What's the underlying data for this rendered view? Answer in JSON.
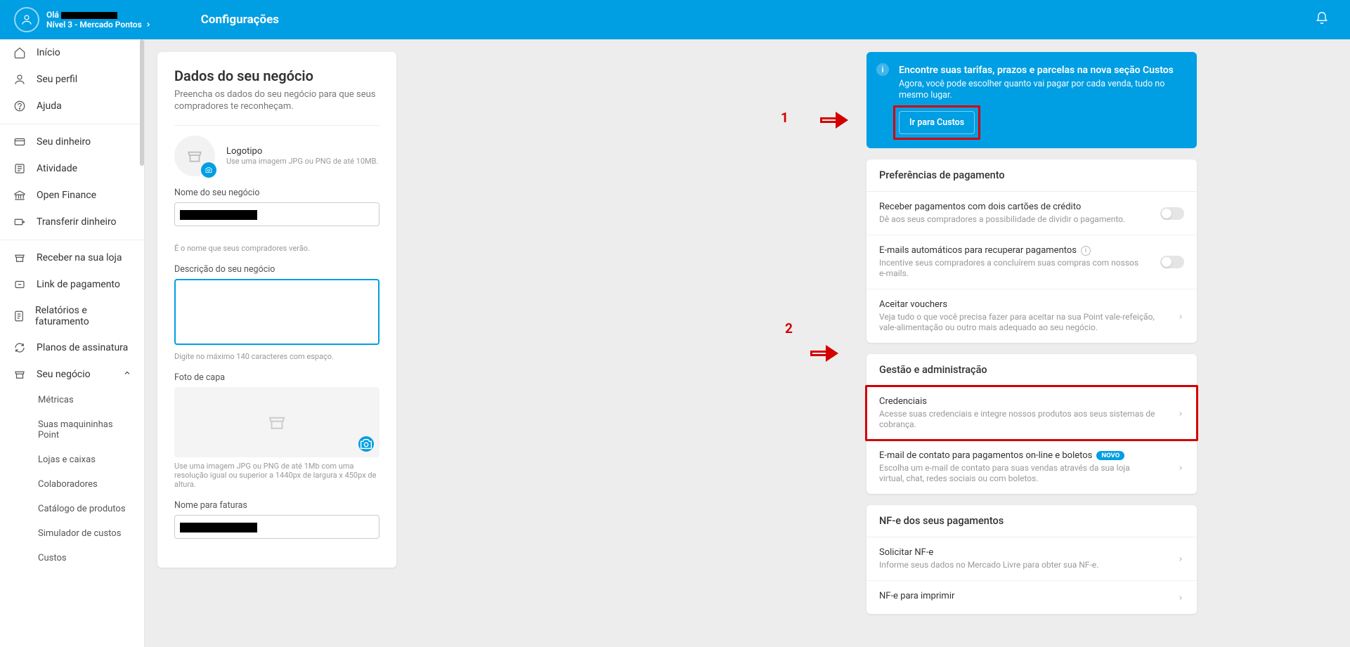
{
  "header": {
    "hello": "Olá",
    "level": "Nível 3 - Mercado Pontos",
    "page_title": "Configurações"
  },
  "sidebar": {
    "items": [
      {
        "label": "Início"
      },
      {
        "label": "Seu perfil"
      },
      {
        "label": "Ajuda"
      },
      {
        "label": "Seu dinheiro"
      },
      {
        "label": "Atividade"
      },
      {
        "label": "Open Finance"
      },
      {
        "label": "Transferir dinheiro"
      },
      {
        "label": "Receber na sua loja"
      },
      {
        "label": "Link de pagamento"
      },
      {
        "label": "Relatórios e faturamento"
      },
      {
        "label": "Planos de assinatura"
      },
      {
        "label": "Seu negócio"
      }
    ],
    "sub": [
      {
        "label": "Métricas"
      },
      {
        "label": "Suas maquininhas Point"
      },
      {
        "label": "Lojas e caixas"
      },
      {
        "label": "Colaboradores"
      },
      {
        "label": "Catálogo de produtos"
      },
      {
        "label": "Simulador de custos"
      },
      {
        "label": "Custos"
      }
    ]
  },
  "left": {
    "title": "Dados do seu negócio",
    "subtitle": "Preencha os dados do seu negócio para que seus compradores te reconheçam.",
    "logo_title": "Logotipo",
    "logo_hint": "Use uma imagem JPG ou PNG de até 10MB.",
    "name_label": "Nome do seu negócio",
    "name_hint": "É o nome que seus compradores verão.",
    "desc_label": "Descrição do seu negócio",
    "desc_hint": "Digite no máximo 140 caracteres com espaço.",
    "cover_label": "Foto de capa",
    "cover_hint": "Use uma imagem JPG ou PNG de até 1Mb com uma resolução igual ou superior a 1440px de largura x 450px de altura.",
    "invoice_label": "Nome para faturas"
  },
  "banner": {
    "title": "Encontre suas tarifas, prazos e parcelas na nova seção Custos",
    "text": "Agora, você pode escolher quanto vai pagar por cada venda, tudo no mesmo lugar.",
    "button": "Ir para Custos"
  },
  "pref": {
    "head": "Preferências de pagamento",
    "r1t": "Receber pagamentos com dois cartões de crédito",
    "r1d": "Dê aos seus compradores a possibilidade de dividir o pagamento.",
    "r2t": "E-mails automáticos para recuperar pagamentos",
    "r2d": "Incentive seus compradores a concluírem suas compras com nossos e-mails.",
    "r3t": "Aceitar vouchers",
    "r3d": "Veja tudo o que você precisa fazer para aceitar na sua Point vale-refeição, vale-alimentação ou outro mais adequado ao seu negócio."
  },
  "gestao": {
    "head": "Gestão e administração",
    "r1t": "Credenciais",
    "r1d": "Acesse suas credenciais e integre nossos produtos aos seus sistemas de cobrança.",
    "r2t": "E-mail de contato para pagamentos on-line e boletos",
    "r2d": "Escolha um e-mail de contato para suas vendas através da sua loja virtual, chat, redes sociais ou com boletos.",
    "r2badge": "NOVO"
  },
  "nfe": {
    "head": "NF-e dos seus pagamentos",
    "r1t": "Solicitar NF-e",
    "r1d": "Informe seus dados no Mercado Livre para obter sua NF-e.",
    "r2t": "NF-e para imprimir"
  },
  "ann": {
    "n1": "1",
    "n2": "2"
  }
}
